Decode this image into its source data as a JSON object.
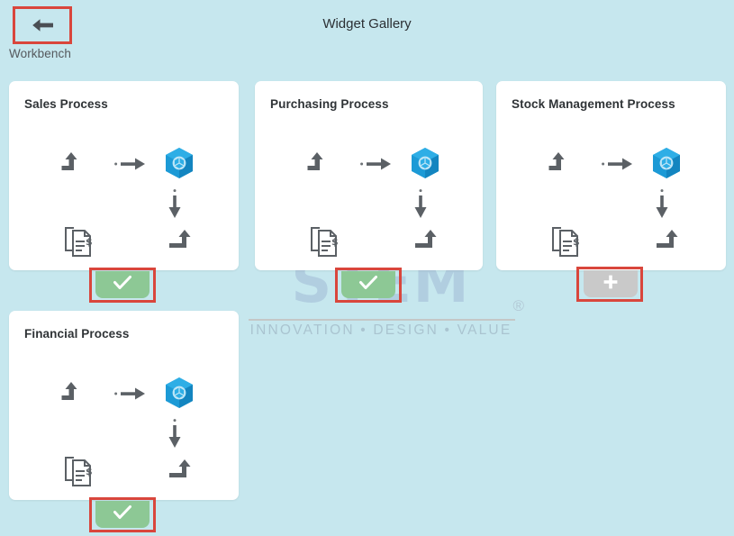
{
  "header": {
    "back_icon": "arrow-left-icon",
    "back_label": "Workbench",
    "title": "Widget Gallery"
  },
  "watermark": {
    "text": "STEM",
    "registered": "®",
    "tagline": "INNOVATION • DESIGN • VALUE"
  },
  "colors": {
    "background": "#c6e7ee",
    "card": "#ffffff",
    "highlight_red": "#d9463c",
    "button_green": "#8dc895",
    "button_gray": "#c9c9c9",
    "cube_blue": "#1c9ad6",
    "icon_gray": "#5b6065",
    "title_text": "#2f3336"
  },
  "cards": [
    {
      "title": "Sales Process",
      "icons": [
        "inbound-arrow-icon",
        "right-arrow-icon",
        "blue-cube-icon",
        "down-arrow-icon",
        "invoice-document-icon",
        "outbound-arrow-icon"
      ],
      "button": {
        "state": "added",
        "icon": "check-icon",
        "symbol": "✓",
        "color": "#8dc895",
        "highlighted": true
      }
    },
    {
      "title": "Purchasing Process",
      "icons": [
        "inbound-arrow-icon",
        "right-arrow-icon",
        "blue-cube-icon",
        "down-arrow-icon",
        "invoice-document-icon",
        "outbound-arrow-icon"
      ],
      "button": {
        "state": "added",
        "icon": "check-icon",
        "symbol": "✓",
        "color": "#8dc895",
        "highlighted": true
      }
    },
    {
      "title": "Stock Management Process",
      "icons": [
        "inbound-arrow-icon",
        "right-arrow-icon",
        "blue-cube-icon",
        "down-arrow-icon",
        "invoice-document-icon",
        "outbound-arrow-icon"
      ],
      "button": {
        "state": "add",
        "icon": "plus-icon",
        "symbol": "+",
        "color": "#c9c9c9",
        "highlighted": true
      }
    },
    {
      "title": "Financial Process",
      "icons": [
        "inbound-arrow-icon",
        "right-arrow-icon",
        "blue-cube-icon",
        "down-arrow-icon",
        "invoice-document-icon",
        "outbound-arrow-icon"
      ],
      "button": {
        "state": "added",
        "icon": "check-icon",
        "symbol": "✓",
        "color": "#8dc895",
        "highlighted": true
      }
    }
  ]
}
